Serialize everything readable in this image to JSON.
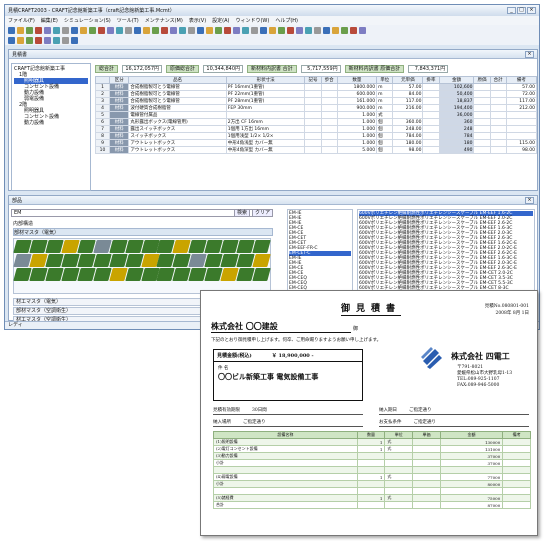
{
  "window": {
    "title": "見積CRAFT2003 - CRAFT記念館新築工事（craft記念館新築工事.Mcmt）",
    "controls": [
      "_",
      "□",
      "×"
    ]
  },
  "menu": [
    "ファイル(F)",
    "編集(E)",
    "シミュレーション(S)",
    "ツール(T)",
    "メンテナンス(M)",
    "表示(V)",
    "設定(A)",
    "ウィンドウ(W)",
    "ヘルプ(H)"
  ],
  "estimate_pane": {
    "title": "見積書",
    "tree": [
      "CRAFT記念館新築工事",
      "1階",
      "照明器具",
      "コンセント設備",
      "動力設備",
      "弱電設備",
      "2階",
      "照明器具",
      "コンセント設備",
      "動力設備"
    ],
    "summary": [
      {
        "label": "総合計",
        "value": "16,172,057円"
      },
      {
        "label": "原価総合計",
        "value": "10,344,840円"
      },
      {
        "label": "新材料内訳書 合計",
        "value": "5,717,559円"
      },
      {
        "label": "新材料内訳書 原価合計",
        "value": "7,843,371円"
      }
    ],
    "columns": [
      "",
      "区分",
      "品名",
      "形状寸法",
      "記号",
      "歩合",
      "数量",
      "単位",
      "元単価",
      "掛率",
      "金額",
      "原価",
      "合計",
      "備考"
    ],
    "rows": [
      {
        "n": "1",
        "k": "材料",
        "name": "合成樹脂製可とう電線管",
        "spec": "PF 16mm(1重管)",
        "q": "1800.000",
        "u": "m",
        "p": "57.00",
        "amt": "102,600",
        "note": "57.00"
      },
      {
        "n": "2",
        "k": "材料",
        "name": "合成樹脂製可とう電線管",
        "spec": "PF 22mm(1重管)",
        "q": "600.000",
        "u": "m",
        "p": "84.00",
        "amt": "50,400",
        "note": "72.00"
      },
      {
        "n": "3",
        "k": "材料",
        "name": "合成樹脂製可とう電線管",
        "spec": "PF 28mm(1重管)",
        "q": "161.000",
        "u": "m",
        "p": "117.00",
        "amt": "18,837",
        "note": "117.00"
      },
      {
        "n": "4",
        "k": "材料",
        "name": "波付硬質合成樹脂管",
        "spec": "FEP 30mm",
        "q": "900.000",
        "u": "m",
        "p": "216.00",
        "amt": "194,400",
        "note": "212.00"
      },
      {
        "n": "5",
        "k": "",
        "name": "電線管付属品",
        "spec": "",
        "q": "1.000",
        "u": "式",
        "p": "",
        "amt": "36,000",
        "note": ""
      },
      {
        "n": "6",
        "k": "材料",
        "name": "丸形露出ボックス(電線管用)",
        "spec": "2方出 CF 16mm",
        "q": "1.000",
        "u": "個",
        "p": "360.00",
        "amt": "360",
        "note": ""
      },
      {
        "n": "7",
        "k": "材料",
        "name": "露出スイッチボックス",
        "spec": "1個用 1方出 16mm",
        "q": "1.000",
        "u": "個",
        "p": "248.00",
        "amt": "248",
        "note": ""
      },
      {
        "n": "8",
        "k": "材料",
        "name": "スイッチボックス",
        "spec": "1個用浅型 1/2× 1/2×",
        "q": "1.000",
        "u": "個",
        "p": "784.00",
        "amt": "784",
        "note": ""
      },
      {
        "n": "9",
        "k": "材料",
        "name": "アウトレットボックス",
        "spec": "中形4角浅型 カバー無",
        "q": "1.000",
        "u": "個",
        "p": "180.00",
        "amt": "180",
        "note": "115.00"
      },
      {
        "n": "10",
        "k": "材料",
        "name": "アウトレットボックス",
        "spec": "中形4角深型 カバー無",
        "q": "5.000",
        "u": "個",
        "p": "98.00",
        "amt": "490",
        "note": "98.00"
      }
    ]
  },
  "parts_pane": {
    "title": "部品",
    "search_value": "EM",
    "search_buttons": [
      "検索",
      "クリア"
    ],
    "labels": [
      "内部構造",
      "部材マスタ（電気）"
    ],
    "bottom_tabs": [
      "材工マスタ（電気）",
      "部材マスタ（空調衛生）",
      "材工マスタ（空調衛生）"
    ],
    "mid_list": [
      "EM-IE",
      "EM-IE",
      "EM-IE",
      "EM-CE",
      "EM-CE",
      "EM-CET",
      "EM-CET",
      "EM-EEF-FR-C",
      "EM-CET-C",
      "EM-IE",
      "EM-IE",
      "EM-CE",
      "EM-CE",
      "EM-CEQ",
      "EM-CEQ",
      "EM-CEQ",
      "EM-CEQ",
      "EM-CEQ",
      "EM-CE2"
    ],
    "mid_selected": 8,
    "right_list": [
      "600Vポリエチレン絶縁耐燃性ポリエチレンシースケーブル EM-EEF 1.6-2C",
      "600Vポリエチレン絶縁耐燃性ポリエチレンシースケーブル EM-EEF 2.0-2C",
      "600Vポリエチレン絶縁耐燃性ポリエチレンシースケーブル EM-EEF 2.6-2C",
      "600Vポリエチレン絶縁耐燃性ポリエチレンシースケーブル EM-EEF 1.6-3C",
      "600Vポリエチレン絶縁耐燃性ポリエチレンシースケーブル EM-EEF 2.0-3C",
      "600Vポリエチレン絶縁耐燃性ポリエチレンシースケーブル EM-EEF 2.6-3C",
      "600Vポリエチレン絶縁耐燃性ポリエチレンシースケーブル EM-EEF 1.6-2C-E",
      "600Vポリエチレン絶縁耐燃性ポリエチレンシースケーブル EM-EEF 2.0-2C-E",
      "600Vポリエチレン絶縁耐燃性ポリエチレンシースケーブル EM-EEF 2.6-2C-E",
      "600Vポリエチレン絶縁耐燃性ポリエチレンシースケーブル EM-EEF 1.6-3C-E",
      "600Vポリエチレン絶縁耐燃性ポリエチレンシースケーブル EM-EEF 2.0-3C-E",
      "600Vポリエチレン絶縁耐燃性ポリエチレンシースケーブル EM-EEF 2.6-3C-E",
      "600Vポリエチレン絶縁耐燃性ポリエチレンシースケーブル EM-CET 2.0-2C",
      "600Vポリエチレン絶縁耐燃性ポリエチレンシースケーブル EM-CET 3.5-3C",
      "600Vポリエチレン絶縁耐燃性ポリエチレンシースケーブル EM-CET 5.5-3C",
      "600Vポリエチレン絶縁耐燃性ポリエチレンシースケーブル EM-CET 8-3C"
    ],
    "right_selected": 0
  },
  "status": "レディ",
  "doc": {
    "title": "御見積書",
    "number": "見積No.080801-001",
    "date": "2008年 8月 1日",
    "customer": "株式会社 〇〇建設",
    "honorific": "御",
    "intro": "下記のとおり御見積申し上げます。何卒、ご用命賜りますようお願い申し上げます。",
    "amount_label": "見積金額(税込)",
    "amount": "￥ 18,900,000 -",
    "project_label": "件 名",
    "project": "〇〇ビル新築工事 電気設備工事",
    "company": "株式会社 四電工",
    "address": [
      "〒791-8021",
      "愛媛県松山市大野乳母1-13",
      "TEL:089-925-1107",
      "FAX:089-946-5000"
    ],
    "conditions": [
      [
        "見積有効期限",
        "30日間"
      ],
      [
        "納入期日",
        "ご指定通り"
      ],
      [
        "納入場所",
        "ご指定通り"
      ],
      [
        "お支払条件",
        "ご指定通り"
      ]
    ],
    "table_cols": [
      "設備名称",
      "数量",
      "単位",
      "単価",
      "金額",
      "備考"
    ],
    "table_rows": [
      [
        "(1)照明設備",
        "1",
        "式",
        "",
        "130000",
        ""
      ],
      [
        "(2)電灯コンセント設備",
        "1",
        "式",
        "",
        "131000",
        ""
      ],
      [
        "(3)動力設備",
        "",
        "",
        "",
        "37000",
        ""
      ],
      [
        "小計",
        "",
        "",
        "",
        "37000",
        ""
      ],
      [
        "",
        "",
        "",
        "",
        "",
        ""
      ],
      [
        "(4)弱電設備",
        "1",
        "式",
        "",
        "77000",
        ""
      ],
      [
        "小計",
        "",
        "",
        "",
        "80000",
        ""
      ],
      [
        "",
        "",
        "",
        "",
        "",
        ""
      ],
      [
        "(5)諸経費",
        "1",
        "式",
        "",
        "75000",
        ""
      ],
      [
        "合計",
        "",
        "",
        "",
        "87000",
        ""
      ]
    ]
  }
}
